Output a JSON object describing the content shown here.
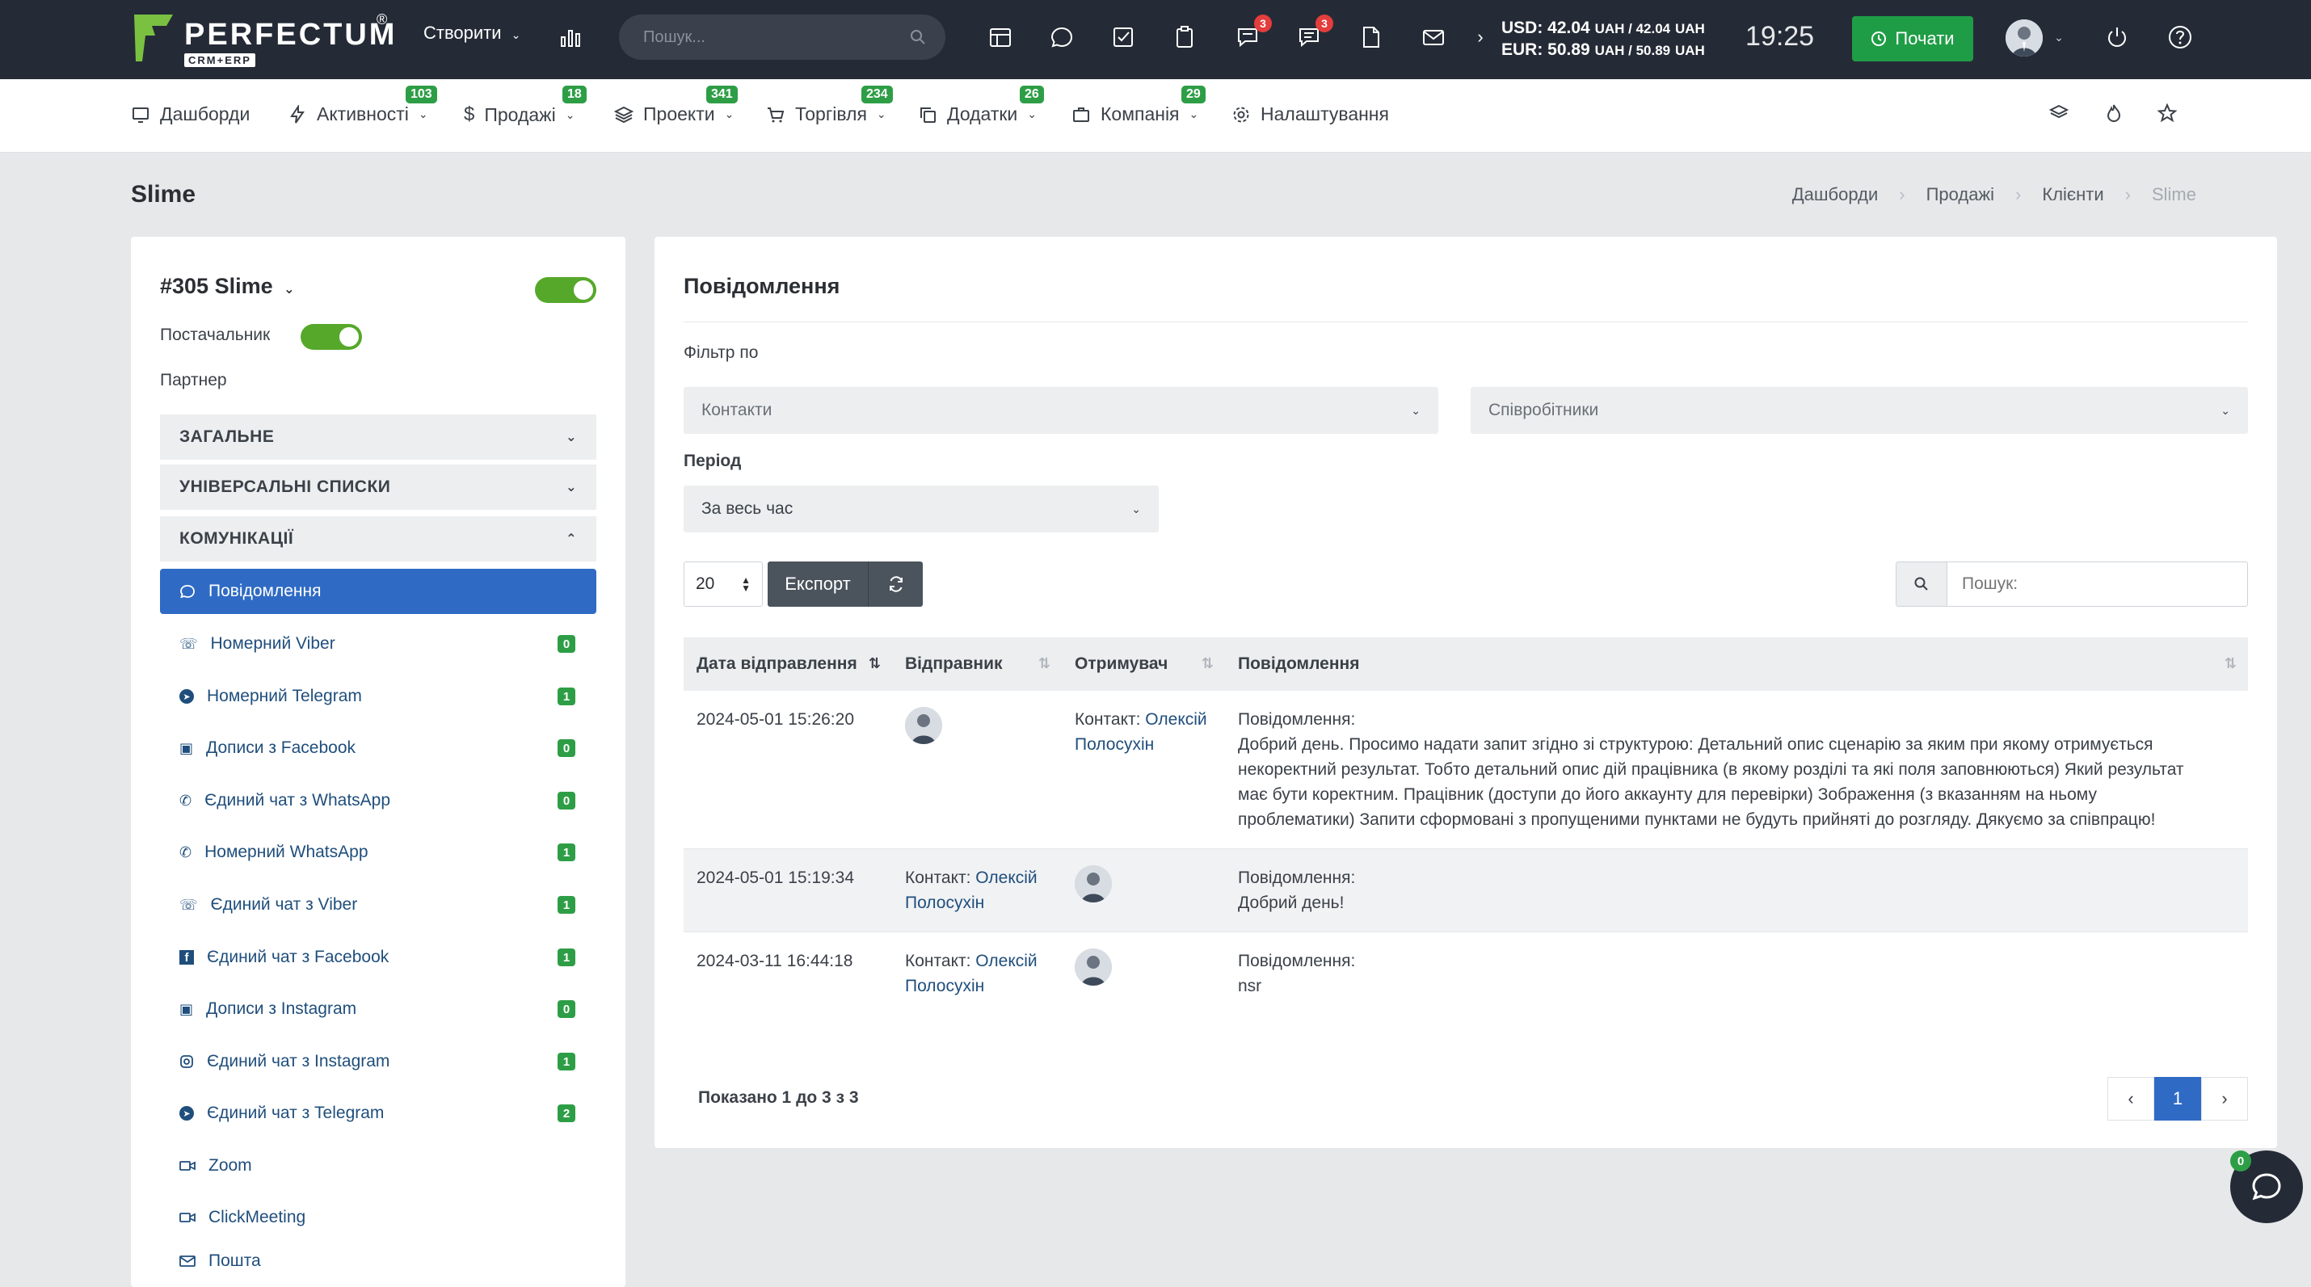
{
  "topbar": {
    "logo_text": "PERFECTUM",
    "logo_reg": "®",
    "logo_sub": "CRM+ERP",
    "create_label": "Створити",
    "search_placeholder": "Пошук...",
    "chat_badge": "3",
    "messages_badge": "3",
    "currency_usd": "USD: 42.04",
    "currency_usd_tail": "UAH / 42.04",
    "currency_usd_unit": "UAH",
    "currency_eur": "EUR: 50.89",
    "currency_eur_tail": "UAH / 50.89",
    "currency_eur_unit": "UAH",
    "time": "19:25",
    "start_label": "Почати"
  },
  "nav": {
    "items": [
      {
        "label": "Дашборди",
        "badge": ""
      },
      {
        "label": "Активності",
        "badge": "103"
      },
      {
        "label": "Продажі",
        "badge": "18"
      },
      {
        "label": "Проекти",
        "badge": "341"
      },
      {
        "label": "Торгівля",
        "badge": "234"
      },
      {
        "label": "Додатки",
        "badge": "26"
      },
      {
        "label": "Компанія",
        "badge": "29"
      },
      {
        "label": "Налаштування",
        "badge": ""
      }
    ]
  },
  "page": {
    "title": "Slime",
    "breadcrumb": [
      "Дашборди",
      "Продажі",
      "Клієнти",
      "Slime"
    ]
  },
  "client": {
    "name": "#305 Slime",
    "supplier_label": "Постачальник",
    "partner_label": "Партнер",
    "sections": [
      "ЗАГАЛЬНЕ",
      "УНІВЕРСАЛЬНІ СПИСКИ",
      "КОМУНІКАЦІЇ"
    ],
    "items": [
      {
        "label": "Повідомлення",
        "badge": "",
        "icon": "chat-icon"
      },
      {
        "label": "Номерний Viber",
        "badge": "0",
        "icon": "viber-icon"
      },
      {
        "label": "Номерний Telegram",
        "badge": "1",
        "icon": "telegram-icon"
      },
      {
        "label": "Дописи з Facebook",
        "badge": "0",
        "icon": "posts-icon"
      },
      {
        "label": "Єдиний чат з WhatsApp",
        "badge": "0",
        "icon": "whatsapp-icon"
      },
      {
        "label": "Номерний WhatsApp",
        "badge": "1",
        "icon": "whatsapp-icon"
      },
      {
        "label": "Єдиний чат з Viber",
        "badge": "1",
        "icon": "viber-icon"
      },
      {
        "label": "Єдиний чат з Facebook",
        "badge": "1",
        "icon": "facebook-icon"
      },
      {
        "label": "Дописи з Instagram",
        "badge": "0",
        "icon": "posts-icon"
      },
      {
        "label": "Єдиний чат з Instagram",
        "badge": "1",
        "icon": "instagram-icon"
      },
      {
        "label": "Єдиний чат з Telegram",
        "badge": "2",
        "icon": "telegram-icon"
      },
      {
        "label": "Zoom",
        "badge": "",
        "icon": "video-icon"
      },
      {
        "label": "ClickMeeting",
        "badge": "",
        "icon": "video-icon"
      },
      {
        "label": "Пошта",
        "badge": "",
        "icon": "mail-icon"
      }
    ]
  },
  "messages": {
    "title": "Повідомлення",
    "filter_label": "Фільтр по",
    "contacts_placeholder": "Контакти",
    "employees_placeholder": "Співробітники",
    "period_label": "Період",
    "period_value": "За весь час",
    "page_size": "20",
    "export_label": "Експорт",
    "search_placeholder": "Пошук:",
    "columns": [
      "Дата відправлення",
      "Відправник",
      "Отримувач",
      "Повідомлення"
    ],
    "rows": [
      {
        "date": "2024-05-01 15:26:20",
        "sender_prefix": "",
        "sender_name": "",
        "recipient_prefix": "Контакт:",
        "recipient_name": "Олексій Полосухін",
        "msg_label": "Повідомлення:",
        "msg_text": "Добрий день. Просимо надати запит згідно зі структурою:  Детальний опис сценарію за яким при якому отримується некоректний результат. Тобто детальний опис дій працівника (в якому розділі та які поля заповнюються)  Який результат має бути коректним.  Працівник (доступи до його аккаунту для перевірки)  Зображення (з вказанням на ньому проблематики) Запити сформовані з пропущеними пунктами не будуть прийняті до розгляду.   Дякуємо за співпрацю!"
      },
      {
        "date": "2024-05-01 15:19:34",
        "sender_prefix": "Контакт:",
        "sender_name": "Олексій Полосухін",
        "recipient_prefix": "",
        "recipient_name": "",
        "msg_label": "Повідомлення:",
        "msg_text": "Добрий день!"
      },
      {
        "date": "2024-03-11 16:44:18",
        "sender_prefix": "Контакт:",
        "sender_name": "Олексій Полосухін",
        "recipient_prefix": "",
        "recipient_name": "",
        "msg_label": "Повідомлення:",
        "msg_text": "nsr"
      }
    ],
    "summary": "Показано 1 до 3 з 3",
    "current_page": "1"
  },
  "chat_fab_badge": "0",
  "colors": {
    "topbar_bg": "#252b36",
    "accent_blue": "#2f6bc4",
    "green": "#2e9e46",
    "toggle_green": "#56a82a",
    "badge_red": "#e43d3d"
  }
}
